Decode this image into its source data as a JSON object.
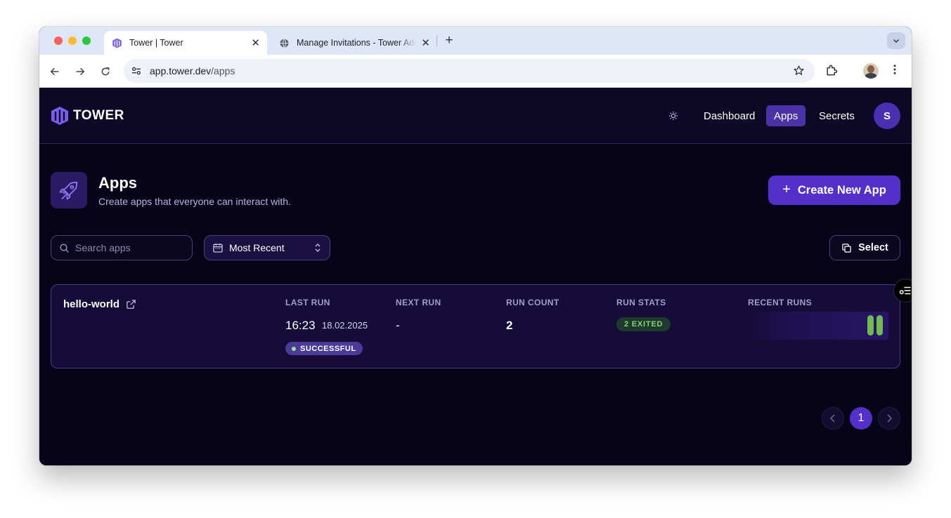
{
  "browser": {
    "tabs": [
      {
        "title": "Tower | Tower",
        "active": true
      },
      {
        "title": "Manage Invitations - Tower Admin",
        "active": false
      }
    ],
    "url_host": "app.tower.dev",
    "url_path": "/apps"
  },
  "header": {
    "logo_text": "TOWER",
    "nav": [
      {
        "label": "Dashboard",
        "active": false
      },
      {
        "label": "Apps",
        "active": true
      },
      {
        "label": "Secrets",
        "active": false
      }
    ],
    "avatar_initial": "S"
  },
  "page": {
    "title": "Apps",
    "subtitle": "Create apps that everyone can interact with.",
    "create_button": "Create New App",
    "search_placeholder": "Search apps",
    "sort_label": "Most Recent",
    "select_button": "Select"
  },
  "columns": {
    "last_run": "LAST RUN",
    "next_run": "NEXT RUN",
    "run_count": "RUN COUNT",
    "run_stats": "RUN STATS",
    "recent_runs": "RECENT RUNS"
  },
  "apps": [
    {
      "name": "hello-world",
      "last_run_time": "16:23",
      "last_run_date": "18.02.2025",
      "status": "SUCCESSFUL",
      "next_run": "-",
      "run_count": "2",
      "run_stats": "2 EXITED",
      "recent_runs": [
        "success",
        "success"
      ]
    }
  ],
  "pagination": {
    "current_page": "1"
  },
  "colors": {
    "background": "#07041a",
    "accent": "#5330c9",
    "success": "#6fbb4f"
  }
}
